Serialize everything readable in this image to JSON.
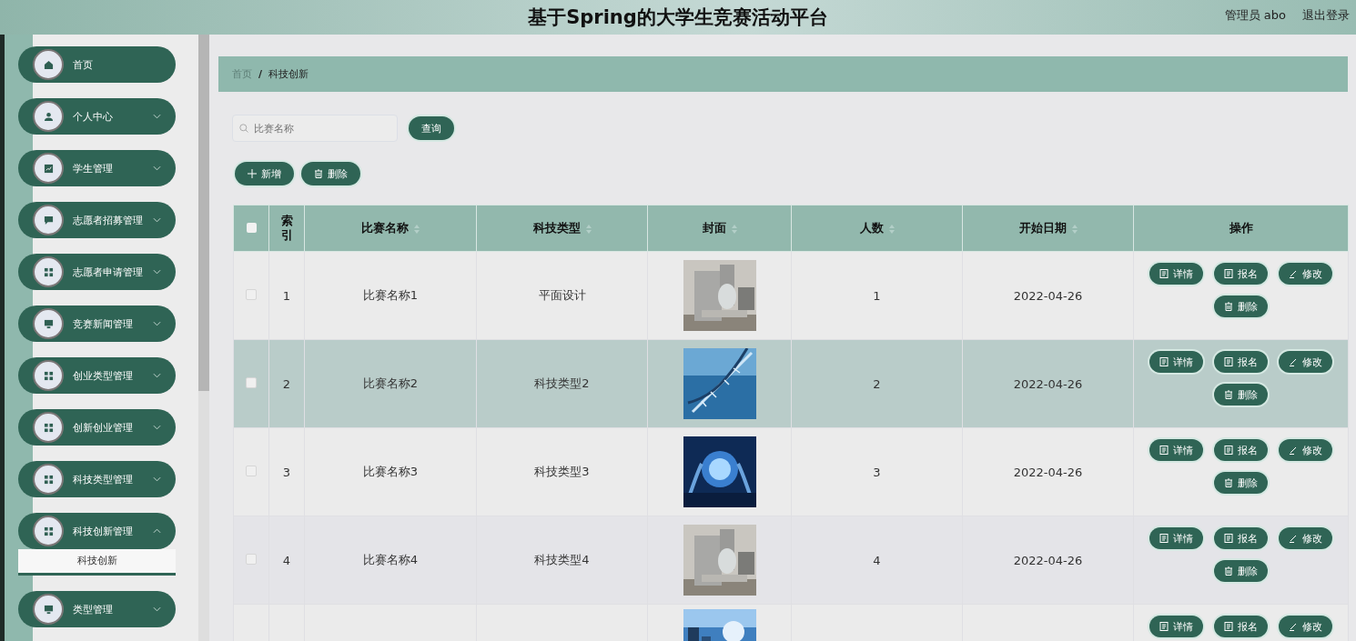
{
  "header": {
    "title": "基于Spring的大学生竞赛活动平台",
    "user": "管理员 abo",
    "logout": "退出登录"
  },
  "sidebar": {
    "items": [
      {
        "label": "首页",
        "kind": "home",
        "expandable": false
      },
      {
        "label": "个人中心",
        "kind": "user",
        "expandable": true,
        "expanded": false
      },
      {
        "label": "学生管理",
        "kind": "chart",
        "expandable": true,
        "expanded": false
      },
      {
        "label": "志愿者招募管理",
        "kind": "chat",
        "expandable": true,
        "expanded": false
      },
      {
        "label": "志愿者申请管理",
        "kind": "grid",
        "expandable": true,
        "expanded": false
      },
      {
        "label": "竞赛新闻管理",
        "kind": "monitor",
        "expandable": true,
        "expanded": false
      },
      {
        "label": "创业类型管理",
        "kind": "grid",
        "expandable": true,
        "expanded": false
      },
      {
        "label": "创新创业管理",
        "kind": "grid",
        "expandable": true,
        "expanded": false
      },
      {
        "label": "科技类型管理",
        "kind": "grid",
        "expandable": true,
        "expanded": false
      },
      {
        "label": "科技创新管理",
        "kind": "grid",
        "expandable": true,
        "expanded": true,
        "children": [
          {
            "label": "科技创新",
            "selected": true
          }
        ]
      },
      {
        "label": "类型管理",
        "kind": "monitor",
        "expandable": true,
        "expanded": false
      }
    ]
  },
  "breadcrumb": {
    "separator": "/",
    "items": [
      {
        "label": "首页"
      },
      {
        "label": "科技创新"
      }
    ]
  },
  "search": {
    "placeholder": "比赛名称",
    "button": "查询"
  },
  "toolbar": [
    {
      "label": "新增",
      "kind": "add"
    },
    {
      "label": "删除",
      "kind": "delete"
    }
  ],
  "table": {
    "columns": [
      {
        "kind": "check",
        "checked": false
      },
      {
        "label": "索引",
        "kind": "index",
        "sortable": false
      },
      {
        "label": "比赛名称",
        "sortable": true
      },
      {
        "label": "科技类型",
        "sortable": true
      },
      {
        "label": "封面",
        "sortable": true
      },
      {
        "label": "人数",
        "sortable": true
      },
      {
        "label": "开始日期",
        "sortable": true
      },
      {
        "label": "操作",
        "sortable": false
      }
    ],
    "rows": [
      {
        "index": "1",
        "name": "比赛名称1",
        "type": "平面设计",
        "cover": {
          "kind": "picture"
        },
        "count": "1",
        "date": "2022-04-26",
        "highlighted": false,
        "checked": false,
        "actions": [
          {
            "label": "详情",
            "kind": "doc"
          },
          {
            "label": "报名",
            "kind": "doc"
          },
          {
            "label": "修改",
            "kind": "edit"
          },
          {
            "label": "删除",
            "kind": "delete"
          }
        ]
      },
      {
        "index": "2",
        "name": "比赛名称2",
        "type": "科技类型2",
        "cover": {
          "kind": "picture"
        },
        "count": "2",
        "date": "2022-04-26",
        "highlighted": true,
        "checked": false,
        "actions": [
          {
            "label": "详情",
            "kind": "doc"
          },
          {
            "label": "报名",
            "kind": "doc"
          },
          {
            "label": "修改",
            "kind": "edit"
          },
          {
            "label": "删除",
            "kind": "delete"
          }
        ]
      },
      {
        "index": "3",
        "name": "比赛名称3",
        "type": "科技类型3",
        "cover": {
          "kind": "picture"
        },
        "count": "3",
        "date": "2022-04-26",
        "highlighted": false,
        "checked": false,
        "actions": [
          {
            "label": "详情",
            "kind": "doc"
          },
          {
            "label": "报名",
            "kind": "doc"
          },
          {
            "label": "修改",
            "kind": "edit"
          },
          {
            "label": "删除",
            "kind": "delete"
          }
        ]
      },
      {
        "index": "4",
        "name": "比赛名称4",
        "type": "科技类型4",
        "cover": {
          "kind": "picture"
        },
        "count": "4",
        "date": "2022-04-26",
        "highlighted": false,
        "checked": false,
        "actions": [
          {
            "label": "详情",
            "kind": "doc"
          },
          {
            "label": "报名",
            "kind": "doc"
          },
          {
            "label": "修改",
            "kind": "edit"
          },
          {
            "label": "删除",
            "kind": "delete"
          }
        ]
      },
      {
        "cover": {
          "kind": "picture"
        },
        "highlighted": false,
        "actions": [
          {
            "label": "详情",
            "kind": "doc"
          },
          {
            "label": "报名",
            "kind": "doc"
          },
          {
            "label": "修改",
            "kind": "edit"
          }
        ]
      }
    ]
  }
}
